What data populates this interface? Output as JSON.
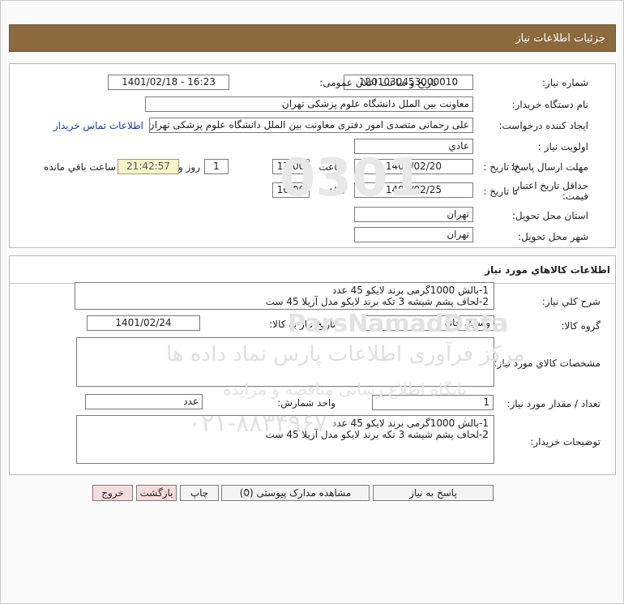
{
  "header": {
    "title": "جزئیات اطلاعات نیاز"
  },
  "need_info": {
    "need_number_label": "شماره نیاز:",
    "need_number": "1201030453000010",
    "announce_label": "تاریخ و ساعت اعلان عمومی:",
    "announce_value": "1401/02/18 - 16:23",
    "buyer_org_label": "نام دستگاه خریدار:",
    "buyer_org": "معاونت بین الملل دانشگاه علوم پزشکی تهران",
    "creator_label": "ایجاد کننده درخواست:",
    "creator": "علی رحمانی متصدی امور دفتری معاونت بین الملل دانشگاه علوم پزشکی تهران",
    "contact_link": "اطلاعات تماس خریدار",
    "priority_label": "اولویت نیاز :",
    "priority": "عادي",
    "deadline_label": "مهلت ارسال پاسخ:",
    "to_date_label": "تا تاریخ :",
    "deadline_date": "1401/02/20",
    "time_label": "ساعت",
    "deadline_time": "17:00",
    "days_value": "1",
    "days_label": "روز و",
    "remaining_time": "21:42:57",
    "remaining_label": "ساعت باقي مانده",
    "validity_label_1": "حداقل تاریخ اعتبار",
    "validity_label_2": "قیمت:",
    "validity_to_label": "تا تاریخ :",
    "validity_date": "1401/02/25",
    "validity_time_label": "ساعت",
    "validity_time": "10:00",
    "province_label": "استان محل تحویل:",
    "province": "تهران",
    "city_label": "شهر محل تحویل:",
    "city": "تهران"
  },
  "goods": {
    "title": "اطلاعات کالاهاي مورد نياز",
    "summary_label": "شرح کلي نياز:",
    "summary_line1": "1-بالش 1000گرمی برند لایکو 45 عدد",
    "summary_line2": "2-لحاف پشم شیشه 3 تکه برند لایکو مدل آزیلا  45 ست",
    "group_label": "گروه کالا:",
    "group_value": "وسایل خانه",
    "need_date_label": "تاریخ نیاز به کالا:",
    "need_date": "1401/02/24",
    "specs_label": "مشخصات کالاي مورد نياز:",
    "specs_value": "",
    "qty_label": "تعداد / مقدار مورد نیاز:",
    "qty_value": "1",
    "unit_label": "واحد شمارش:",
    "unit_value": "عدد",
    "buyer_notes_label": "توضیحات خریدار:",
    "notes_line1": "1-بالش 1000گرمی برند لایکو 45 عدد",
    "notes_line2": "2-لحاف پشم شیشه 3 تکه برند لایکو مدل آزیلا  45 ست"
  },
  "actions": {
    "reply": "پاسخ به نیاز",
    "attachments": "مشاهده مدارک پیوستی (0)",
    "print": "چاپ",
    "back": "بازگشت",
    "exit": "خروج"
  },
  "watermark": {
    "line1": "ParsNamadData",
    "line2": "مرکز فرآوری اطلاعات پارس نماد داده ها",
    "line3": "پایگاه اطلاع رسانی مناقصه و مزایده",
    "line4": "۰۲۱-۸۸۳۴۹۶۷۰"
  }
}
